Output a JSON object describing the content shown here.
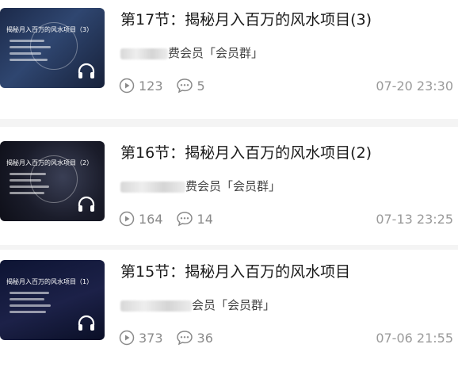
{
  "episodes": [
    {
      "thumbnail_title": "揭秘月入百万的风水项目（3）",
      "title": "第17节：揭秘月入百万的风水项目(3)",
      "meta_suffix": "费会员「会员群」",
      "plays": "123",
      "comments": "5",
      "date": "07-20 23:30"
    },
    {
      "thumbnail_title": "揭秘月入百万的风水项目（2）",
      "title": "第16节：揭秘月入百万的风水项目(2)",
      "meta_suffix": "费会员「会员群」",
      "plays": "164",
      "comments": "14",
      "date": "07-13 23:25"
    },
    {
      "thumbnail_title": "揭秘月入百万的风水项目（1）",
      "title": "第15节：揭秘月入百万的风水项目",
      "meta_suffix": "会员「会员群」",
      "plays": "373",
      "comments": "36",
      "date": "07-06 21:55"
    }
  ],
  "colors": {
    "text_primary": "#1a1a1a",
    "text_secondary": "#8a8a8a",
    "separator": "#f4f4f4"
  }
}
